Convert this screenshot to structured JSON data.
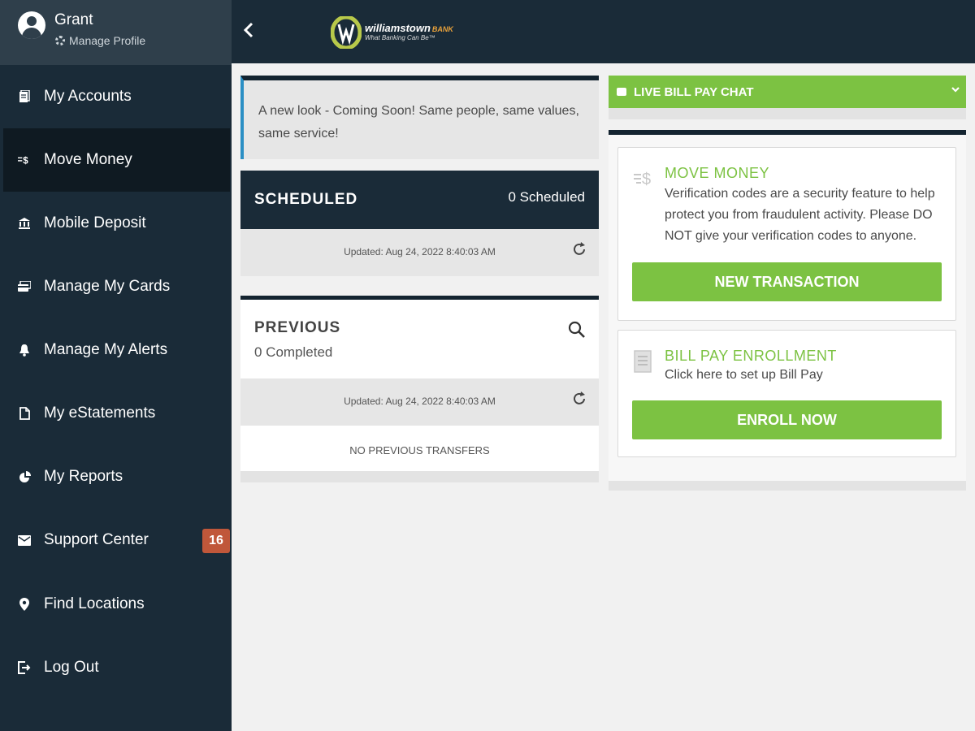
{
  "profile": {
    "name": "Grant",
    "manage_label": "Manage Profile"
  },
  "nav": {
    "items": [
      {
        "label": "My Accounts",
        "icon": "accounts-icon"
      },
      {
        "label": "Move Money",
        "icon": "move-money-icon",
        "active": true
      },
      {
        "label": "Mobile Deposit",
        "icon": "bank-icon"
      },
      {
        "label": "Manage My Cards",
        "icon": "cards-icon"
      },
      {
        "label": "Manage My Alerts",
        "icon": "bell-icon"
      },
      {
        "label": "My eStatements",
        "icon": "document-icon"
      },
      {
        "label": "My Reports",
        "icon": "pie-chart-icon"
      },
      {
        "label": "Support Center",
        "icon": "envelope-icon",
        "badge": "16"
      },
      {
        "label": "Find Locations",
        "icon": "map-pin-icon"
      },
      {
        "label": "Log Out",
        "icon": "logout-icon"
      }
    ]
  },
  "brand": {
    "name": "williamstown",
    "bank_word": "BANK",
    "tagline": "What Banking Can Be™",
    "colors": {
      "primary": "#1a2b38",
      "accent": "#7cc242",
      "badge": "#c0573a",
      "logo_accent": "#e9a23b"
    }
  },
  "notice": {
    "text": "A new look - Coming Soon!  Same people, same values, same service!"
  },
  "scheduled": {
    "title": "SCHEDULED",
    "count": "0 Scheduled",
    "updated": "Updated: Aug 24, 2022 8:40:03 AM"
  },
  "previous": {
    "title": "PREVIOUS",
    "count": "0 Completed",
    "updated": "Updated: Aug 24, 2022 8:40:03 AM",
    "empty": "NO PREVIOUS TRANSFERS"
  },
  "chat": {
    "label": "LIVE BILL PAY CHAT"
  },
  "move_money": {
    "title": "MOVE MONEY",
    "text": "Verification codes are a security feature to help protect you from fraudulent activity.  Please DO NOT give your verification codes to anyone.",
    "button": "NEW TRANSACTION"
  },
  "bill_pay": {
    "title": "BILL PAY ENROLLMENT",
    "text": "Click here to set up Bill Pay",
    "button": "ENROLL NOW"
  }
}
